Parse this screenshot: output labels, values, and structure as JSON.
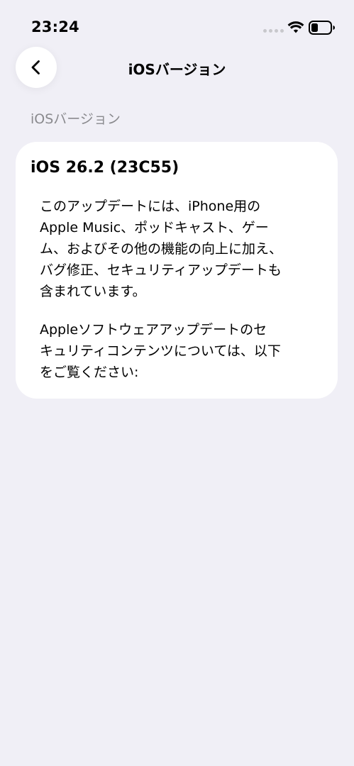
{
  "status_bar": {
    "time": "23:24"
  },
  "nav": {
    "title": "iOSバージョン",
    "back_icon": "chevron-left-icon"
  },
  "section": {
    "header": "iOSバージョン"
  },
  "card": {
    "version": "iOS 26.2 (23C55)",
    "description_1": "このアップデートには、iPhone用の\nApple Music、ポッドキャスト、ゲー\nム、およびその他の機能の向上に加え、\nバグ修正、セキュリティアップデートも\n含まれています。",
    "description_2": "Appleソフトウェアアップデートのセ\nキュリティコンテンツについては、以下\nをご覧ください:"
  },
  "colors": {
    "background": "#f0eff6",
    "card": "#ffffff",
    "section_header": "#8a8a8e"
  }
}
